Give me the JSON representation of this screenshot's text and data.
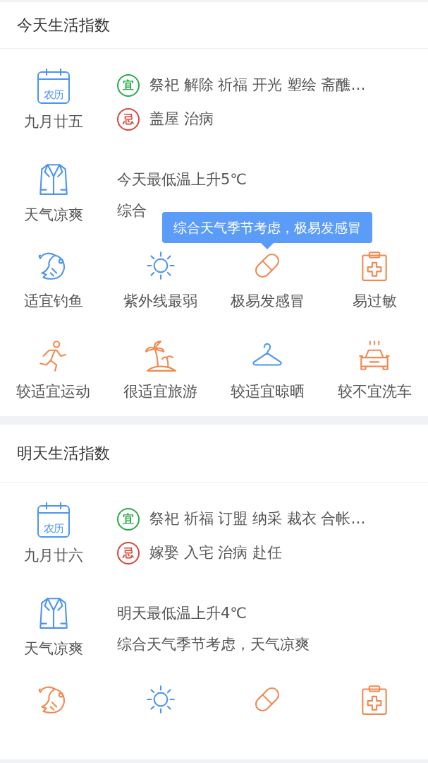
{
  "sections": [
    {
      "title": "今天生活指数",
      "calendar": {
        "icon_text": "农历",
        "date": "九月廿五"
      },
      "almanac": [
        {
          "kind": "good",
          "mark": "宜",
          "text": "祭祀 解除 祈福 开光 塑绘 斋醮…"
        },
        {
          "kind": "bad",
          "mark": "忌",
          "text": "盖屋 治病"
        }
      ],
      "weather": {
        "label": "天气凉爽",
        "lines": [
          "今天最低温上升5℃",
          "综合"
        ]
      },
      "tiles": [
        {
          "kind": "fish",
          "color": "#4d94f0",
          "label": "适宜钓鱼"
        },
        {
          "kind": "sun",
          "color": "#4d94f0",
          "label": "紫外线最弱"
        },
        {
          "kind": "pill",
          "color": "#f0894f",
          "label": "极易发感冒",
          "tooltip": "综合天气季节考虑，极易发感冒"
        },
        {
          "kind": "medical",
          "color": "#f0894f",
          "label": "易过敏"
        },
        {
          "kind": "runner",
          "color": "#f0894f",
          "label": "较适宜运动"
        },
        {
          "kind": "palm",
          "color": "#f0894f",
          "label": "很适宜旅游"
        },
        {
          "kind": "hanger",
          "color": "#4d94f0",
          "label": "较适宜晾晒"
        },
        {
          "kind": "car",
          "color": "#f0894f",
          "label": "较不宜洗车"
        }
      ]
    },
    {
      "title": "明天生活指数",
      "calendar": {
        "icon_text": "农历",
        "date": "九月廿六"
      },
      "almanac": [
        {
          "kind": "good",
          "mark": "宜",
          "text": "祭祀 祈福 订盟 纳采 裁衣 合帐…"
        },
        {
          "kind": "bad",
          "mark": "忌",
          "text": "嫁娶 入宅 治病 赴任"
        }
      ],
      "weather": {
        "label": "天气凉爽",
        "lines": [
          "明天最低温上升4℃",
          "综合天气季节考虑，天气凉爽"
        ]
      },
      "tiles": [
        {
          "kind": "fish",
          "color": "#f0894f"
        },
        {
          "kind": "sun",
          "color": "#4d94f0"
        },
        {
          "kind": "pill",
          "color": "#f0894f"
        },
        {
          "kind": "medical",
          "color": "#f0894f"
        }
      ]
    }
  ]
}
